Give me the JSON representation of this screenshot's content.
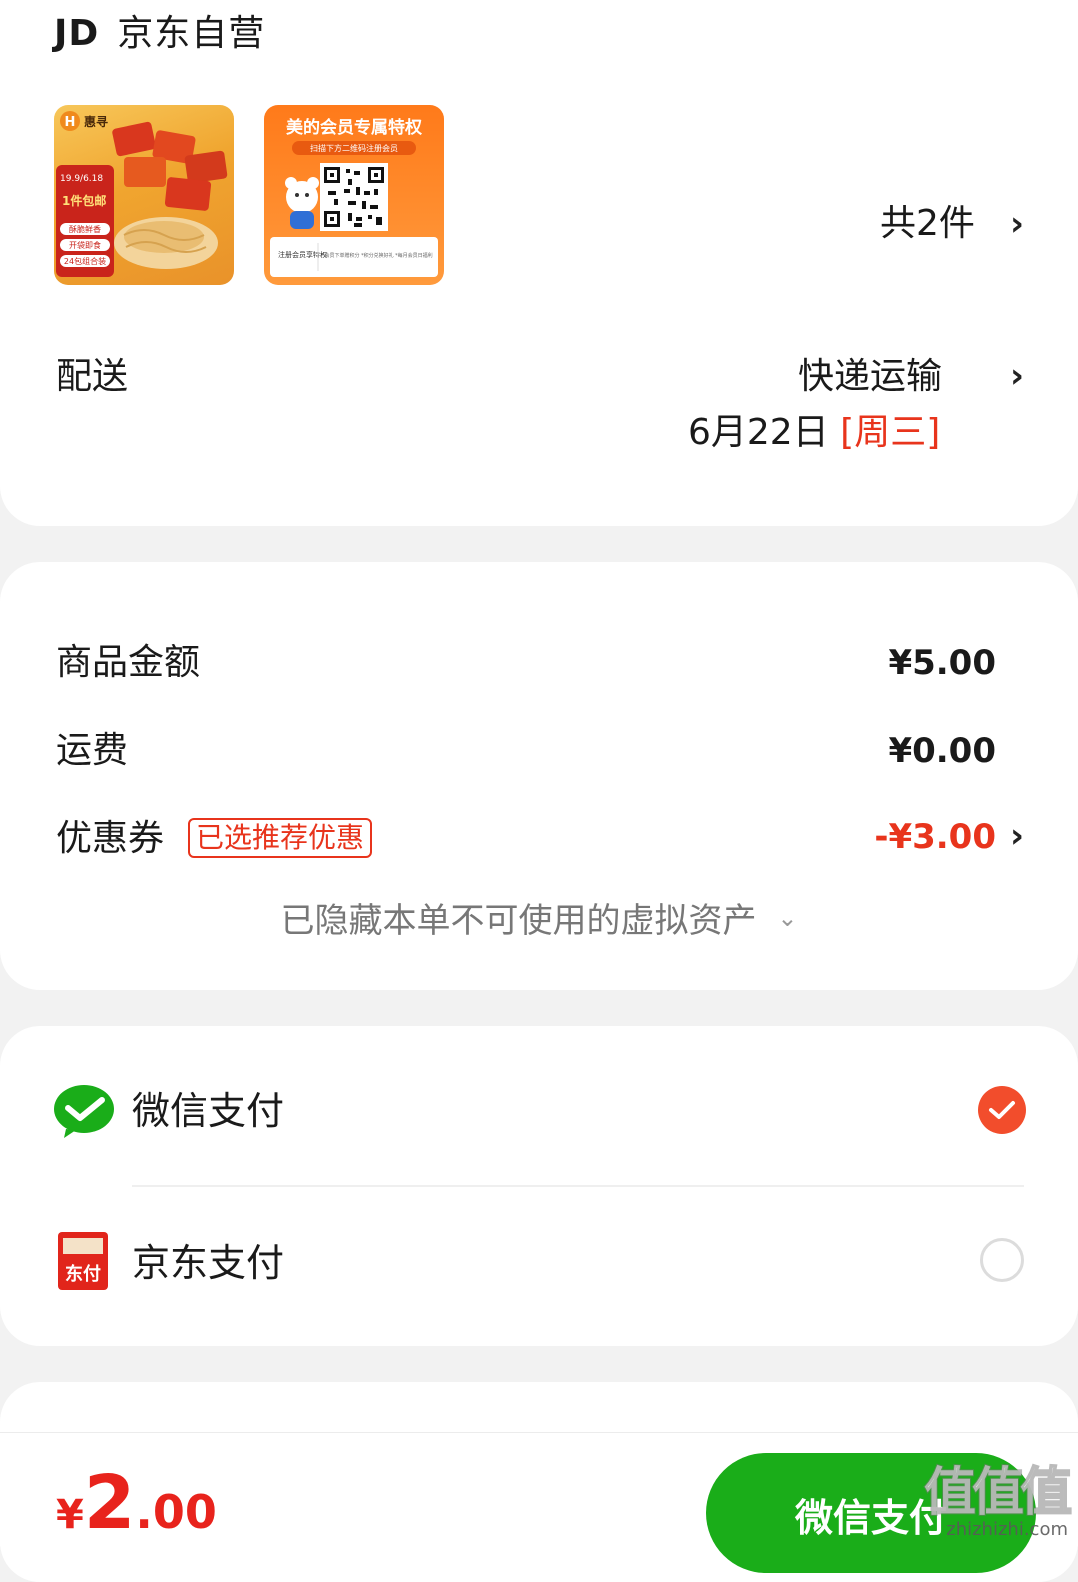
{
  "store": {
    "logo": "JD",
    "name": "京东自营",
    "item_count_label": "共2件"
  },
  "thumb1": {
    "brand": "惠寻",
    "promo": "1件包邮",
    "badge": "19.9/6.18",
    "line1": "酥脆鲜香",
    "line2": "开袋即食",
    "line3": "24包组合装"
  },
  "thumb2": {
    "title": "美的会员专属特权",
    "subtitle": "扫描下方二维码注册会员",
    "footer_left": "注册会员享特权",
    "footer_right": "*会员下单赠积分 *积分兑换好礼 *每月会员日福利"
  },
  "delivery": {
    "label": "配送",
    "method": "快递运输",
    "date": "6月22日",
    "weekday": "[周三]"
  },
  "amounts": {
    "goods_label": "商品金额",
    "goods_value": "¥5.00",
    "shipping_label": "运费",
    "shipping_value": "¥0.00",
    "coupon_label": "优惠券",
    "coupon_tag": "已选推荐优惠",
    "coupon_value": "-¥3.00",
    "hidden_assets": "已隐藏本单不可使用的虚拟资产"
  },
  "payment": {
    "wechat_label": "微信支付",
    "jd_label": "京东支付",
    "jd_icon_text": "东付",
    "selected": "wechat"
  },
  "bottom": {
    "currency": "¥",
    "total_int": "2",
    "total_dec": ".00",
    "pay_button": "微信支付"
  },
  "watermark": {
    "main": "值值值",
    "sub": "zhizhizhi.com"
  },
  "colors": {
    "accent_red": "#e8341c",
    "wechat_green": "#1aad19",
    "check_orange": "#f24d2c"
  }
}
